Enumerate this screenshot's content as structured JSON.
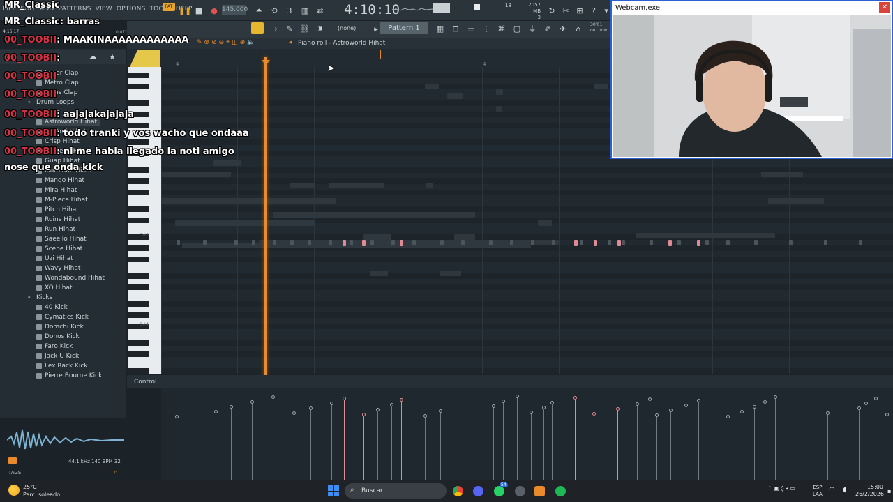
{
  "app": {
    "menu": [
      "FILE",
      "EDIT",
      "ADD",
      "PATTERNS",
      "VIEW",
      "OPTIONS",
      "TOOLS",
      "HELP"
    ],
    "pat_badge": "PAT",
    "tempo": "145.000",
    "song_time": "4:10:10",
    "memory": "2057 MB",
    "voices": "3",
    "cpu_val": "18",
    "pattern": "Pattern 1",
    "none_select": "(none)",
    "snap_info_1": "30/01",
    "snap_info_2": "out now!",
    "time_left": "4:16:17",
    "time_small": "0'07\""
  },
  "piano_roll": {
    "title": "Piano roll - Astroworld Hihat",
    "timeline_marks": [
      "4",
      "4"
    ],
    "key_labels": [
      "C#5",
      "C#4"
    ],
    "control_label": "Control"
  },
  "browser": {
    "items": [
      {
        "label": "Lager Clap",
        "indent": 52
      },
      {
        "label": "Metro Clap",
        "indent": 52
      },
      {
        "label": "Ruins Clap",
        "indent": 52
      },
      {
        "label": "Drum Loops",
        "indent": 40,
        "folder": true
      },
      {
        "label": "Hi-Hats",
        "indent": 40,
        "folder": true
      },
      {
        "label": "Astroworld Hihat",
        "indent": 52,
        "selected": true
      },
      {
        "label": "Control Hihat",
        "indent": 52
      },
      {
        "label": "Crisp Hihat",
        "indent": 52
      },
      {
        "label": "Gin$eng Hihat",
        "indent": 52
      },
      {
        "label": "Guap Hihat",
        "indent": 52
      },
      {
        "label": "Illuminae Hihat",
        "indent": 52
      },
      {
        "label": "Mango Hihat",
        "indent": 52
      },
      {
        "label": "Mira Hihat",
        "indent": 52
      },
      {
        "label": "M-Piece Hihat",
        "indent": 52
      },
      {
        "label": "Pitch Hihat",
        "indent": 52
      },
      {
        "label": "Ruins Hihat",
        "indent": 52
      },
      {
        "label": "Run Hihat",
        "indent": 52
      },
      {
        "label": "Saeello Hihat",
        "indent": 52
      },
      {
        "label": "Scene Hihat",
        "indent": 52
      },
      {
        "label": "Uzi Hihat",
        "indent": 52
      },
      {
        "label": "Wavy Hihat",
        "indent": 52
      },
      {
        "label": "Wondabound Hihat",
        "indent": 52
      },
      {
        "label": "XO Hihat",
        "indent": 52
      },
      {
        "label": "Kicks",
        "indent": 40,
        "folder": true
      },
      {
        "label": "40 Kick",
        "indent": 52
      },
      {
        "label": "Cymatics Kick",
        "indent": 52
      },
      {
        "label": "Domchi Kick",
        "indent": 52
      },
      {
        "label": "Donos Kick",
        "indent": 52
      },
      {
        "label": "Faro Kick",
        "indent": 52
      },
      {
        "label": "Jack U Kick",
        "indent": 52
      },
      {
        "label": "Lex Rack Kick",
        "indent": 52
      },
      {
        "label": "Pierre Bourne Kick",
        "indent": 52
      }
    ],
    "wave_info": "44.1 kHz 140 BPM 32",
    "tags": "TAGS"
  },
  "chat": [
    {
      "user": "MR_Classic",
      "text": "",
      "user_color": "#ffffff"
    },
    {
      "user": "MR_Classic",
      "text": ": barras",
      "user_color": "#ffffff"
    },
    {
      "user": "00_TOOBII",
      "text": ": MAAKINAAAAAAAAAAAA",
      "user_color": "#d23445"
    },
    {
      "user": "00_TOOBII",
      "text": ":",
      "user_color": "#d23445"
    },
    {
      "user": "00_TOOBII",
      "text": "",
      "user_color": "#d23445"
    },
    {
      "user": "00_TOOBII",
      "text": "",
      "user_color": "#d23445"
    },
    {
      "user": "00_TOOBII",
      "text": ": aajajakajajaja",
      "user_color": "#d23445"
    },
    {
      "user": "00_TOOBII",
      "text": ": todo tranki y vos wacho que ondaaa",
      "user_color": "#d23445"
    },
    {
      "user": "00_TOOBII",
      "text": ": ni me habia llegado la noti amigo",
      "user_color": "#d23445"
    },
    {
      "user": "",
      "text": "nose que onda kick",
      "user_color": "#ffffff"
    }
  ],
  "webcam": {
    "title": "Webcam.exe",
    "close": "✕"
  },
  "taskbar": {
    "temp": "25°C",
    "weather": "Parc. soleado",
    "search": "Buscar",
    "lang_1": "ESP",
    "lang_2": "LAA",
    "time": "15:00",
    "date": "26/2/2026",
    "badge": "54"
  },
  "colors": {
    "accent_orange": "#e98a2c",
    "selected_note": "#e08a95",
    "chat_user": "#d23445",
    "webcam_border": "#2b5fd6"
  }
}
